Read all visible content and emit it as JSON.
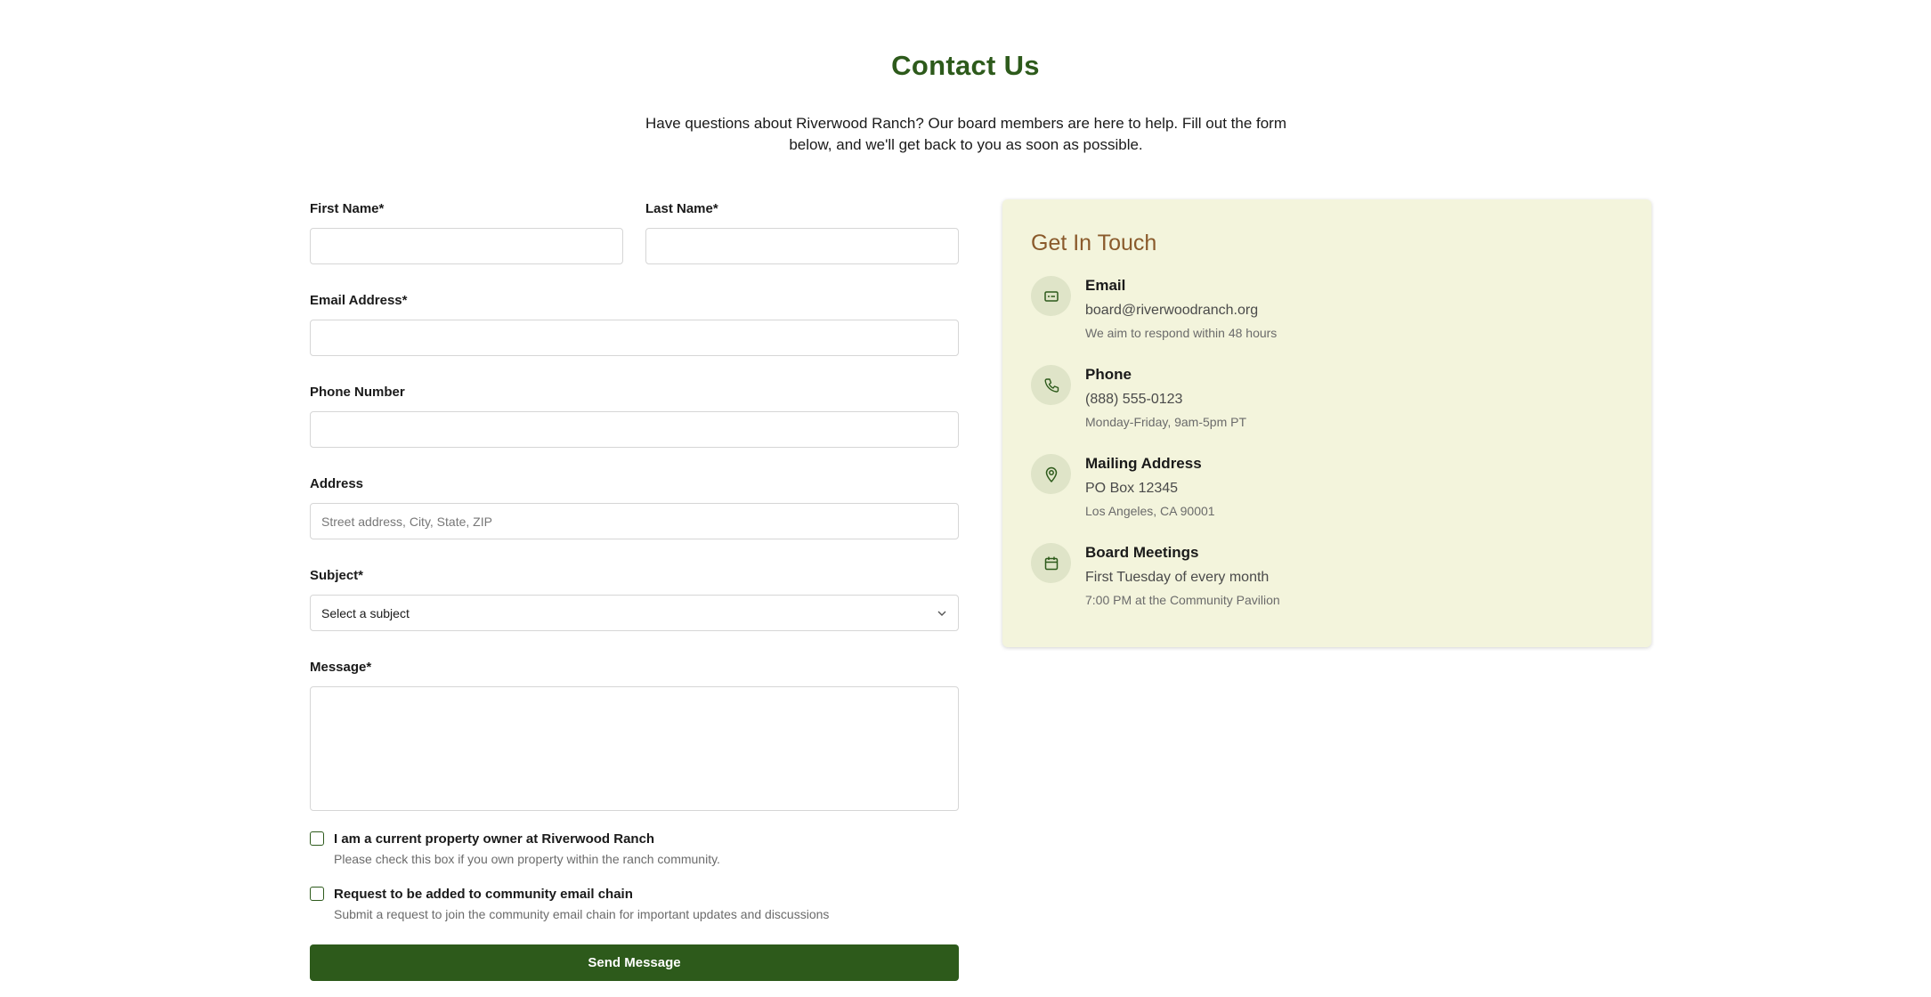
{
  "header": {
    "title": "Contact Us",
    "intro": "Have questions about Riverwood Ranch? Our board members are here to help. Fill out the form below, and we'll get back to you as soon as possible."
  },
  "form": {
    "first_name": {
      "label": "First Name*",
      "value": ""
    },
    "last_name": {
      "label": "Last Name*",
      "value": ""
    },
    "email": {
      "label": "Email Address*",
      "value": ""
    },
    "phone": {
      "label": "Phone Number",
      "value": ""
    },
    "address": {
      "label": "Address",
      "placeholder": "Street address, City, State, ZIP",
      "value": ""
    },
    "subject": {
      "label": "Subject*",
      "selected": "Select a subject"
    },
    "message": {
      "label": "Message*",
      "value": ""
    },
    "owner_check": {
      "label": "I am a current property owner at Riverwood Ranch",
      "help": "Please check this box if you own property within the ranch community.",
      "checked": false
    },
    "email_chain_check": {
      "label": "Request to be added to community email chain",
      "help": "Submit a request to join the community email chain for important updates and discussions",
      "checked": false
    },
    "submit_label": "Send Message"
  },
  "contact_card": {
    "title": "Get In Touch",
    "items": [
      {
        "icon": "email-icon",
        "title": "Email",
        "main": "board@riverwoodranch.org",
        "sub": "We aim to respond within 48 hours"
      },
      {
        "icon": "phone-icon",
        "title": "Phone",
        "main": "(888) 555-0123",
        "sub": "Monday-Friday, 9am-5pm PT"
      },
      {
        "icon": "map-pin-icon",
        "title": "Mailing Address",
        "main": "PO Box 12345",
        "sub": "Los Angeles, CA 90001"
      },
      {
        "icon": "calendar-icon",
        "title": "Board Meetings",
        "main": "First Tuesday of every month",
        "sub": "7:00 PM at the Community Pavilion"
      }
    ]
  },
  "colors": {
    "primary": "#2d5a1b",
    "card_bg": "#f3f4dc",
    "card_title": "#8a5a2b",
    "icon_bg": "#dfe4c8"
  }
}
